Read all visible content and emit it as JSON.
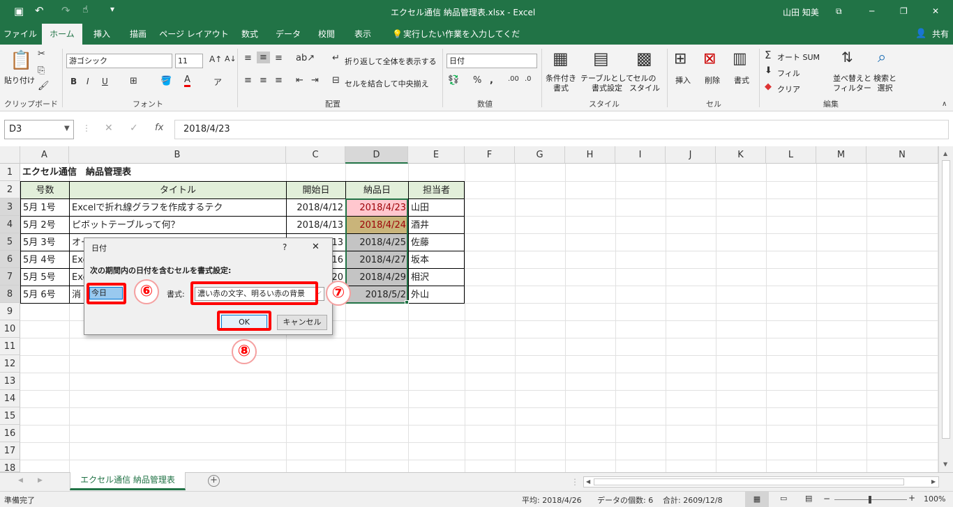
{
  "titlebar": {
    "title": "エクセル通信 納品管理表.xlsx  -  Excel",
    "user": "山田 知美"
  },
  "tabs": [
    "ファイル",
    "ホーム",
    "挿入",
    "描画",
    "ページ レイアウト",
    "数式",
    "データ",
    "校閲",
    "表示"
  ],
  "tell_me": "実行したい作業を入力してください",
  "share": "共有",
  "ribbon": {
    "paste": "貼り付け",
    "clipboard": "クリップボード",
    "font_name": "游ゴシック",
    "font_size": "11",
    "font_group": "フォント",
    "wrap": "折り返して全体を表示する",
    "merge": "セルを結合して中央揃え",
    "align_group": "配置",
    "number_format": "日付",
    "number_group": "数値",
    "cond_format": "条件付き\n書式",
    "table_format": "テーブルとして\n書式設定",
    "cell_style": "セルの\nスタイル",
    "style_group": "スタイル",
    "insert": "挿入",
    "delete": "削除",
    "format": "書式",
    "cells_group": "セル",
    "autosum": "オート SUM",
    "fill": "フィル",
    "clear": "クリア",
    "sort": "並べ替えと\nフィルター",
    "find": "検索と\n選択",
    "edit_group": "編集"
  },
  "formula": {
    "namebox": "D3",
    "value": "2018/4/23"
  },
  "columns": [
    "A",
    "B",
    "C",
    "D",
    "E",
    "F",
    "G",
    "H",
    "I",
    "J",
    "K",
    "L",
    "M",
    "N"
  ],
  "rows": [
    "1",
    "2",
    "3",
    "4",
    "5",
    "6",
    "7",
    "8",
    "9",
    "10",
    "11",
    "12",
    "13",
    "14",
    "15",
    "16",
    "17",
    "18"
  ],
  "sheet": {
    "title": "エクセル通信　納品管理表",
    "headers": [
      "号数",
      "タイトル",
      "開始日",
      "納品日",
      "担当者"
    ],
    "data": [
      [
        "5月 1号",
        "Excelで折れ線グラフを作成するテク",
        "2018/4/12",
        "2018/4/23",
        "山田"
      ],
      [
        "5月 2号",
        "ピボットテーブルって何？",
        "2018/4/13",
        "2018/4/24",
        "酒井"
      ],
      [
        "5月 3号",
        "オート",
        "2018/4/13",
        "2018/4/25",
        "佐藤"
      ],
      [
        "5月 4号",
        "Exc",
        "16",
        "2018/4/27",
        "坂本"
      ],
      [
        "5月 5号",
        "Exc",
        "20",
        "2018/4/29",
        "相沢"
      ],
      [
        "5月 6号",
        "消",
        "",
        "2018/5/2",
        "外山"
      ]
    ]
  },
  "dialog": {
    "title": "日付",
    "help": "?",
    "close": "✕",
    "prompt": "次の期間内の日付を含むセルを書式設定:",
    "period": "今日",
    "format_label": "書式:",
    "format_value": "濃い赤の文字、明るい赤の背景",
    "ok": "OK",
    "cancel": "キャンセル"
  },
  "markers": [
    "⑥",
    "⑦",
    "⑧"
  ],
  "sheet_tab": "エクセル通信  納品管理表",
  "status": {
    "ready": "準備完了",
    "average": "平均: 2018/4/26",
    "count": "データの個数: 6",
    "sum": "合計: 2609/12/8",
    "zoom": "100%"
  },
  "colors": {
    "excel_green": "#217346",
    "header_fill": "#e2efda",
    "light_red": "#ffc7ce",
    "dark_red": "#9c0006",
    "gold": "#c9b47a",
    "gray": "#c4c4c4"
  }
}
